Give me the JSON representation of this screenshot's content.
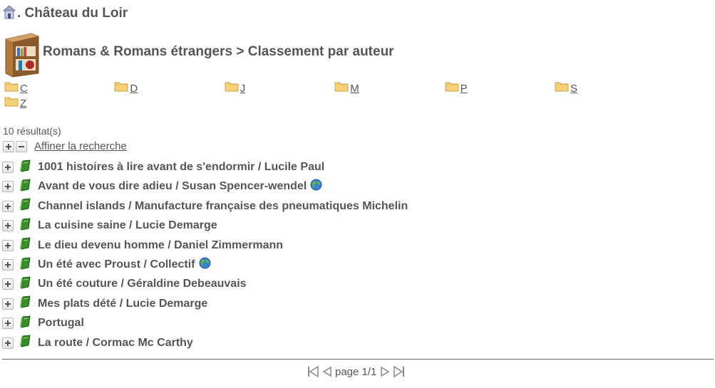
{
  "header": {
    "library_name": ". Château du Loir"
  },
  "shelf": {
    "path": "Romans & Romans étrangers > Classement par auteur"
  },
  "letters": [
    "C",
    "D",
    "J",
    "M",
    "P",
    "S",
    "Z"
  ],
  "results": {
    "count_text": "10 résultat(s)",
    "refine_label": "Affiner la recherche",
    "items": [
      {
        "title": "1001 histoires à lire avant de s'endormir / Lucile Paul",
        "web": false
      },
      {
        "title": "Avant de vous dire adieu / Susan Spencer-wendel",
        "web": true
      },
      {
        "title": "Channel islands / Manufacture française des pneumatiques Michelin",
        "web": false
      },
      {
        "title": "La cuisine saine / Lucie Demarge",
        "web": false
      },
      {
        "title": "Le dieu devenu homme / Daniel Zimmermann",
        "web": false
      },
      {
        "title": "Un été avec Proust / Collectif",
        "web": true
      },
      {
        "title": "Un été couture / Géraldine Debeauvais",
        "web": false
      },
      {
        "title": "Mes plats dété / Lucie Demarge",
        "web": false
      },
      {
        "title": "Portugal",
        "web": false
      },
      {
        "title": "La route / Cormac Mc Carthy",
        "web": false
      }
    ]
  },
  "pagination": {
    "text": "page 1/1"
  },
  "colors": {
    "text": "#555555",
    "folder": "#f5d27a",
    "book": "#3a8a2e"
  }
}
